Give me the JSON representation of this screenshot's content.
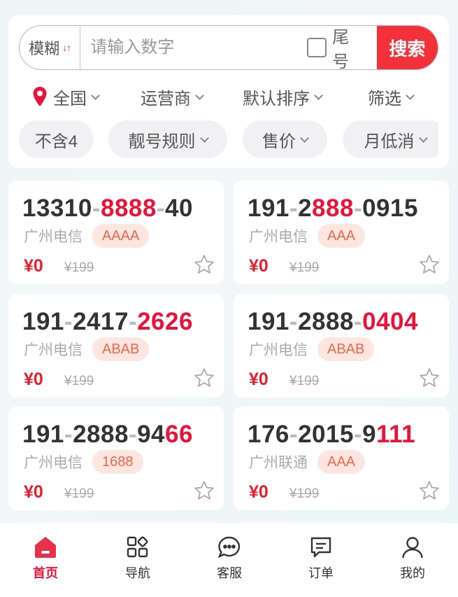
{
  "search": {
    "mode_label": "模糊",
    "placeholder": "请输入数字",
    "tail_label": "尾号",
    "button_label": "搜索"
  },
  "filters": [
    {
      "label": "全国"
    },
    {
      "label": "运营商"
    },
    {
      "label": "默认排序"
    },
    {
      "label": "筛选"
    }
  ],
  "pills": [
    {
      "label": "不含4"
    },
    {
      "label": "靓号规则"
    },
    {
      "label": "售价"
    },
    {
      "label": "月低消"
    }
  ],
  "cards": [
    {
      "parts": [
        [
          "13310",
          "n"
        ],
        [
          "-",
          "d"
        ],
        [
          "8888",
          "r"
        ],
        [
          "-",
          "d"
        ],
        [
          "40",
          "n"
        ]
      ],
      "carrier": "广州电信",
      "tag": "AAAA",
      "price": "¥0",
      "original_price": "¥199"
    },
    {
      "parts": [
        [
          "191",
          "n"
        ],
        [
          "-",
          "d"
        ],
        [
          "2",
          "n"
        ],
        [
          "888",
          "r"
        ],
        [
          "-",
          "d"
        ],
        [
          "0915",
          "n"
        ]
      ],
      "carrier": "广州电信",
      "tag": "AAA",
      "price": "¥0",
      "original_price": "¥199"
    },
    {
      "parts": [
        [
          "191",
          "n"
        ],
        [
          "-",
          "d"
        ],
        [
          "2417",
          "n"
        ],
        [
          "-",
          "d"
        ],
        [
          "2626",
          "r"
        ]
      ],
      "carrier": "广州电信",
      "tag": "ABAB",
      "price": "¥0",
      "original_price": "¥199"
    },
    {
      "parts": [
        [
          "191",
          "n"
        ],
        [
          "-",
          "d"
        ],
        [
          "2888",
          "n"
        ],
        [
          "-",
          "d"
        ],
        [
          "0404",
          "r"
        ]
      ],
      "carrier": "广州电信",
      "tag": "ABAB",
      "price": "¥0",
      "original_price": "¥199"
    },
    {
      "parts": [
        [
          "191",
          "n"
        ],
        [
          "-",
          "d"
        ],
        [
          "2888",
          "n"
        ],
        [
          "-",
          "d"
        ],
        [
          "94",
          "n"
        ],
        [
          "66",
          "r"
        ]
      ],
      "carrier": "广州电信",
      "tag": "1688",
      "price": "¥0",
      "original_price": "¥199"
    },
    {
      "parts": [
        [
          "176",
          "n"
        ],
        [
          "-",
          "d"
        ],
        [
          "2015",
          "n"
        ],
        [
          "-",
          "d"
        ],
        [
          "9",
          "n"
        ],
        [
          "111",
          "r"
        ]
      ],
      "carrier": "广州联通",
      "tag": "AAA",
      "price": "¥0",
      "original_price": "¥199"
    }
  ],
  "nav": [
    {
      "label": "首页",
      "icon": "home-icon",
      "active": true
    },
    {
      "label": "导航",
      "icon": "grid-icon",
      "active": false
    },
    {
      "label": "客服",
      "icon": "chat-icon",
      "active": false
    },
    {
      "label": "订单",
      "icon": "order-icon",
      "active": false
    },
    {
      "label": "我的",
      "icon": "user-icon",
      "active": false
    }
  ],
  "colors": {
    "accent": "#e8123a",
    "search_button": "#f2313b",
    "tag_bg": "#fde6e0",
    "tag_text": "#f0684a"
  }
}
